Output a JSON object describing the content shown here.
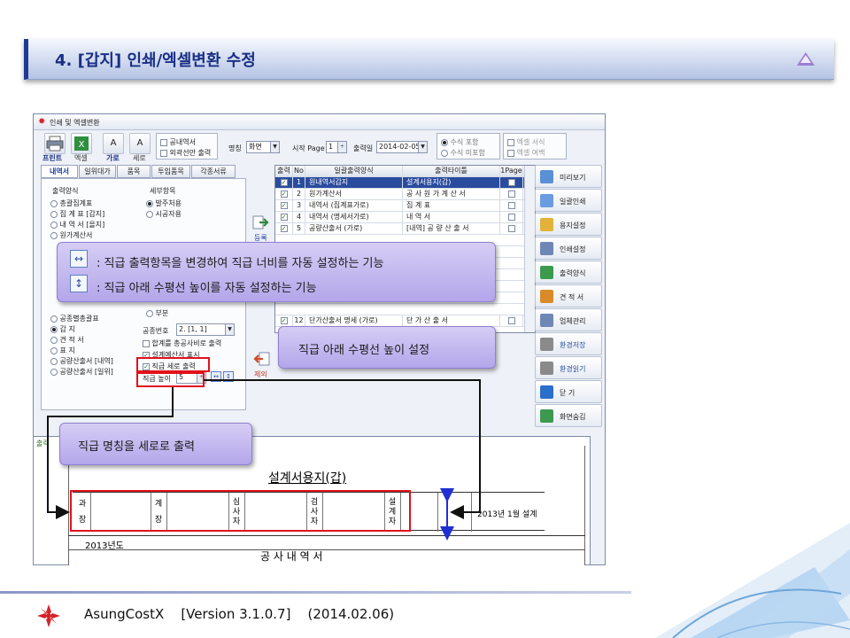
{
  "slide": {
    "title": "4. [갑지] 인쇄/엑셀변환 수정"
  },
  "window": {
    "title": "인쇄 및 엑셀변환",
    "toolbar": {
      "print_label": "프린트",
      "excel_label": "엑셀",
      "horizontal_label": "가로",
      "vertical_label": "세로",
      "public_only_label": "공내역서",
      "outline_only_label": "외곽선만 출력",
      "name_label": "명칭",
      "name_value": "화면",
      "start_page_label": "시작 Page",
      "start_page_value": "1",
      "print_date_label": "출력일",
      "print_date_value": "2014-02-05",
      "include_formula_label": "수식 포함",
      "exclude_formula_label": "수식 미포함",
      "excel_format_label": "엑셀 서식",
      "excel_margin_label": "엑셀 여백"
    },
    "tabs": [
      {
        "label": "내역서"
      },
      {
        "label": "일위대가"
      },
      {
        "label": "품목"
      },
      {
        "label": "투입품목"
      },
      {
        "label": "각종서류"
      }
    ],
    "output_group": {
      "label": "출력양식",
      "options": [
        "총괄집계표",
        "집 계 표 [갑지]",
        "내 역 서 [을지]",
        "원가계산서"
      ],
      "options2": [
        "공종별총괄표",
        "갑 지",
        "견 적 서",
        "표 지",
        "공량산출서 [내역]",
        "공량산출서 [일위]"
      ]
    },
    "detail_group": {
      "label": "세부항목",
      "options": [
        "발주처용",
        "시공자용"
      ],
      "partial_label": "부분"
    },
    "settings": {
      "process_no_label": "공종번호",
      "process_no_value": "2. [1, 1]",
      "sum_label": "합계를 총공사비로 출력",
      "design_label": "설계예산서 표시",
      "vertical_print_label": "직급 세로 출력",
      "height_label": "직급 높이",
      "height_value": "5"
    },
    "register_label": "등록",
    "remove_label": "제외",
    "grid": {
      "headers": [
        "출력",
        "No",
        "일괄출력양식",
        "출력타이틀",
        "1Page"
      ],
      "rows": [
        {
          "no": "1",
          "form": "원내역서갑지",
          "title": "설계서용지(갑)"
        },
        {
          "no": "2",
          "form": "원가계산서",
          "title": "공 사 원 가 계 산 서"
        },
        {
          "no": "3",
          "form": "내역서 (집계표가로)",
          "title": "집      계      표"
        },
        {
          "no": "4",
          "form": "내역서 (명세서가로)",
          "title": "내      역      서"
        },
        {
          "no": "5",
          "form": "공량산출서 (가로)",
          "title": "[내역] 공 량 산 출 서"
        },
        {
          "no": "12",
          "form": "단가산출서 명세 (가로)",
          "title": "단   가   산   출   서"
        }
      ]
    },
    "side_buttons": [
      {
        "label": "미리보기",
        "color": "#5b8fd6"
      },
      {
        "label": "일괄인쇄",
        "color": "#6b9be0"
      },
      {
        "label": "용지설정",
        "color": "#e2b23a"
      },
      {
        "label": "인쇄설정",
        "color": "#6f87b5"
      },
      {
        "label": "출력양식",
        "color": "#3c9a4f"
      },
      {
        "label": "견 적 서",
        "color": "#d98a2a"
      },
      {
        "label": "업체관리",
        "color": "#6f87b5"
      },
      {
        "label": "환경저장",
        "color": "#8a8a8a"
      },
      {
        "label": "환경읽기",
        "color": "#8a8a8a"
      },
      {
        "label": "닫    기",
        "color": "#2a6fc9"
      },
      {
        "label": "화면숨김",
        "color": "#3c9a4f"
      }
    ],
    "preview": {
      "tab_label": "출력",
      "doc_title": "설계서용지(갑)",
      "cells": [
        "과장",
        "계장",
        "심사자",
        "검사자",
        "설계자"
      ],
      "date_text": "2013년 1월  설계",
      "year_text": "2013년도",
      "section_title": "공   사   내   역   서"
    }
  },
  "callouts": {
    "width_feature": ": 직급 출력항목을 변경하여 직급 너비를 자동 설정하는 기능",
    "height_feature": ": 직급 아래 수평선 높이를 자동 설정하는 기능",
    "line_height": "직급 아래 수평선 높이 설정",
    "vertical_print": "직급 명칭을 세로로 출력"
  },
  "footer": {
    "product": "AsungCostX",
    "version": "[Version 3.1.0.7]",
    "date": "(2014.02.06)"
  },
  "colors": {
    "accent": "#1a2f86",
    "highlight": "#e1121b",
    "callout": "#b4a6ea",
    "arrow_blue": "#1f2fd1"
  }
}
